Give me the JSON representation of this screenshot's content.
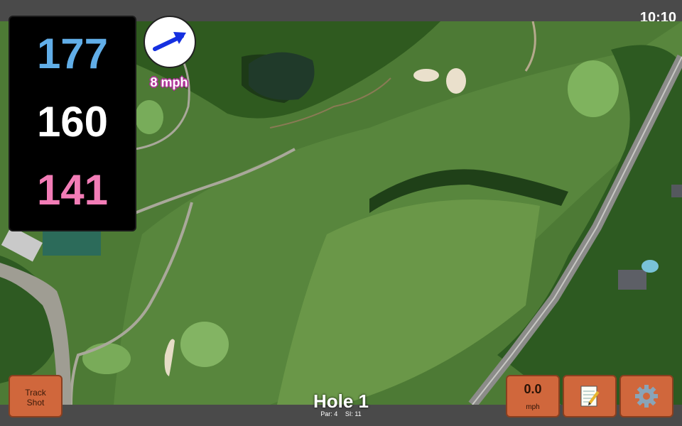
{
  "status": {
    "time": "10:10"
  },
  "distances": {
    "back": "177",
    "middle": "160",
    "front": "141"
  },
  "wind": {
    "speed_label": "8 mph",
    "direction_icon": "arrow-icon"
  },
  "hole": {
    "title": "Hole 1",
    "par_label": "Par: 4",
    "si_label": "SI: 11"
  },
  "buttons": {
    "track_line1": "Track",
    "track_line2": "Shot",
    "shot_speed_value": "0.0",
    "shot_speed_unit": "mph",
    "notes_icon": "notepad-icon",
    "settings_icon": "gear-icon"
  },
  "colors": {
    "accent_button": "#d0673c",
    "back_distance": "#61aee8",
    "front_distance": "#f27cb6"
  }
}
